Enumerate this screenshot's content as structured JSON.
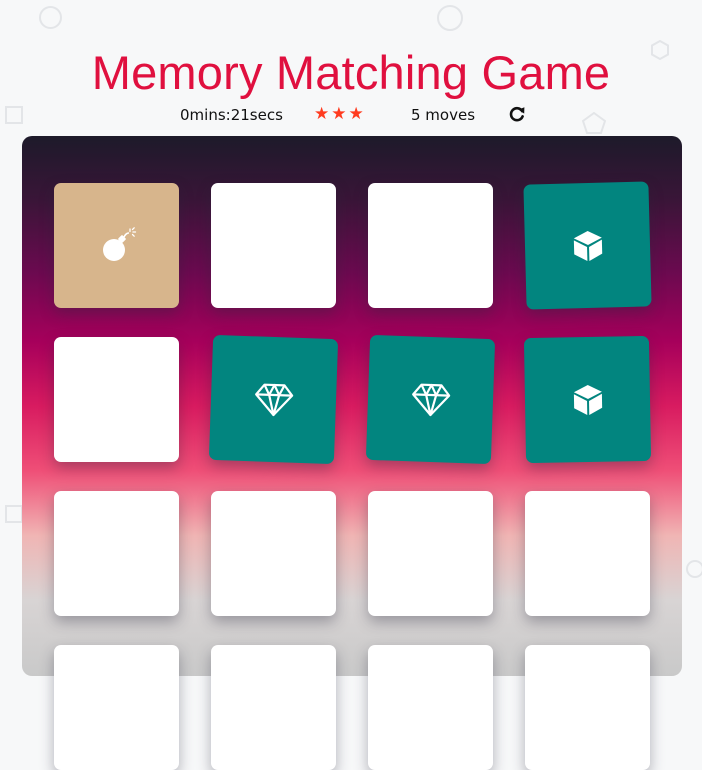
{
  "title": "Memory Matching Game",
  "score": {
    "timer": "0mins:21secs",
    "star_count": 3,
    "stars": [
      "★",
      "★",
      "★"
    ],
    "moves": "5 moves",
    "restart_icon": "repeat-icon"
  },
  "colors": {
    "title": "#e0103f",
    "star": "#ff3b1f",
    "card_closed": "#ffffff",
    "card_open": "#d7b58c",
    "card_match": "#02857f"
  },
  "cards": [
    {
      "state": "open",
      "icon": "bomb-icon"
    },
    {
      "state": "closed",
      "icon": ""
    },
    {
      "state": "closed",
      "icon": ""
    },
    {
      "state": "match",
      "icon": "cube-icon"
    },
    {
      "state": "closed",
      "icon": ""
    },
    {
      "state": "match",
      "icon": "diamond-icon"
    },
    {
      "state": "match",
      "icon": "diamond-icon"
    },
    {
      "state": "match",
      "icon": "cube-icon"
    },
    {
      "state": "closed",
      "icon": ""
    },
    {
      "state": "closed",
      "icon": ""
    },
    {
      "state": "closed",
      "icon": ""
    },
    {
      "state": "closed",
      "icon": ""
    },
    {
      "state": "closed",
      "icon": ""
    },
    {
      "state": "closed",
      "icon": ""
    },
    {
      "state": "closed",
      "icon": ""
    },
    {
      "state": "closed",
      "icon": ""
    }
  ]
}
